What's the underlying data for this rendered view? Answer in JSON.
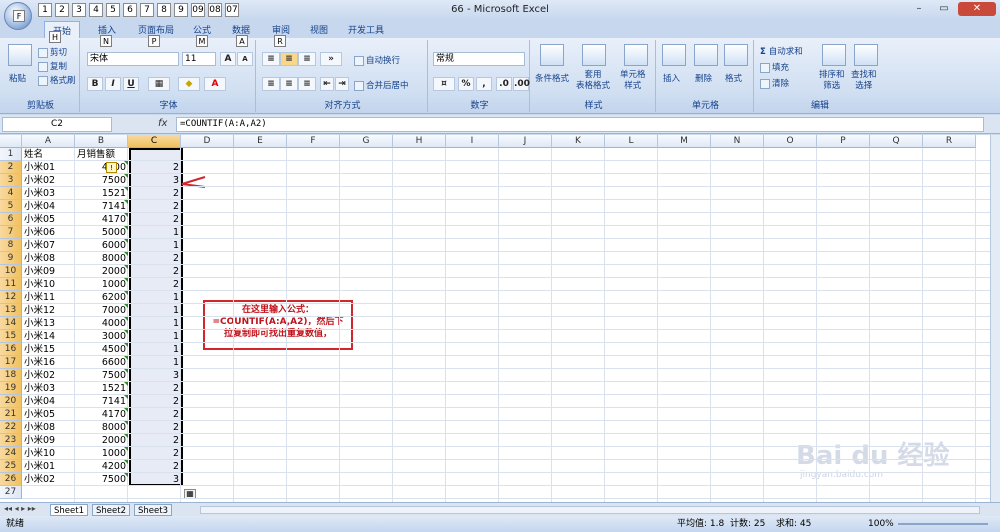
{
  "window": {
    "title": "66 - Microsoft Excel",
    "office_button_key": "F"
  },
  "qat_keys": [
    "1",
    "2",
    "3",
    "4",
    "5",
    "6",
    "7",
    "8",
    "9",
    "09",
    "08",
    "07"
  ],
  "tabs": [
    {
      "label": "开始",
      "key": "H"
    },
    {
      "label": "插入",
      "key": "N"
    },
    {
      "label": "页面布局",
      "key": "P"
    },
    {
      "label": "公式",
      "key": "M"
    },
    {
      "label": "数据",
      "key": "A"
    },
    {
      "label": "审阅",
      "key": "R"
    },
    {
      "label": "视图",
      "key": ""
    },
    {
      "label": "开发工具",
      "key": ""
    }
  ],
  "ribbon": {
    "clipboard": {
      "label": "剪贴板",
      "paste": "粘贴",
      "cut": "剪切",
      "copy": "复制",
      "painter": "格式刷"
    },
    "font": {
      "label": "字体",
      "name": "宋体",
      "size": "11",
      "bold": "B",
      "italic": "I",
      "underline": "U",
      "grow": "A",
      "shrink": "A"
    },
    "align": {
      "label": "对齐方式",
      "wrap": "自动换行",
      "merge": "合并后居中"
    },
    "number": {
      "label": "数字",
      "format": "常规",
      "percent": "%",
      "comma": ","
    },
    "styles": {
      "label": "样式",
      "cond": "条件格式",
      "table": "套用\n表格格式",
      "cell": "单元格\n样式"
    },
    "cells": {
      "label": "单元格",
      "insert": "插入",
      "delete": "删除",
      "format": "格式"
    },
    "edit": {
      "label": "编辑",
      "autosum": "自动求和",
      "fill": "填充",
      "clear": "清除",
      "sort": "排序和\n筛选",
      "find": "查找和\n选择"
    }
  },
  "formula_bar": {
    "name_box": "C2",
    "fx": "fx",
    "formula": "=COUNTIF(A:A,A2)"
  },
  "columns": [
    "A",
    "B",
    "C",
    "D",
    "E",
    "F",
    "G",
    "H",
    "I",
    "J",
    "K",
    "L",
    "M",
    "N",
    "O",
    "P",
    "Q",
    "R"
  ],
  "selected_column": "C",
  "header_row": {
    "a": "姓名",
    "b": "月销售额"
  },
  "rows": [
    {
      "a": "小米01",
      "b": "4200",
      "c": "2"
    },
    {
      "a": "小米02",
      "b": "7500",
      "c": "3"
    },
    {
      "a": "小米03",
      "b": "1521",
      "c": "2"
    },
    {
      "a": "小米04",
      "b": "7141",
      "c": "2"
    },
    {
      "a": "小米05",
      "b": "4170",
      "c": "2"
    },
    {
      "a": "小米06",
      "b": "5000",
      "c": "1"
    },
    {
      "a": "小米07",
      "b": "6000",
      "c": "1"
    },
    {
      "a": "小米08",
      "b": "8000",
      "c": "2"
    },
    {
      "a": "小米09",
      "b": "2000",
      "c": "2"
    },
    {
      "a": "小米10",
      "b": "1000",
      "c": "2"
    },
    {
      "a": "小米11",
      "b": "6200",
      "c": "1"
    },
    {
      "a": "小米12",
      "b": "7000",
      "c": "1"
    },
    {
      "a": "小米13",
      "b": "4000",
      "c": "1"
    },
    {
      "a": "小米14",
      "b": "3000",
      "c": "1"
    },
    {
      "a": "小米15",
      "b": "4500",
      "c": "1"
    },
    {
      "a": "小米16",
      "b": "6600",
      "c": "1"
    },
    {
      "a": "小米02",
      "b": "7500",
      "c": "3"
    },
    {
      "a": "小米03",
      "b": "1521",
      "c": "2"
    },
    {
      "a": "小米04",
      "b": "7141",
      "c": "2"
    },
    {
      "a": "小米05",
      "b": "4170",
      "c": "2"
    },
    {
      "a": "小米08",
      "b": "8000",
      "c": "2"
    },
    {
      "a": "小米09",
      "b": "2000",
      "c": "2"
    },
    {
      "a": "小米10",
      "b": "1000",
      "c": "2"
    },
    {
      "a": "小米01",
      "b": "4200",
      "c": "2"
    },
    {
      "a": "小米02",
      "b": "7500",
      "c": "3"
    }
  ],
  "empty_row_number": "27",
  "callout": {
    "line1": "在这里输入公式：",
    "line2": "=COUNTIF(A:A,A2)，然后下",
    "line3": "拉复制即可找出重复数值，"
  },
  "sheets": [
    "Sheet1",
    "Sheet2",
    "Sheet3"
  ],
  "status": {
    "ready": "就绪",
    "average": "平均值: 1.8",
    "count": "计数: 25",
    "sum": "求和: 45",
    "zoom": "100%"
  },
  "watermark": {
    "text": "Bai du 经验",
    "url": "jingyan.baidu.com"
  }
}
